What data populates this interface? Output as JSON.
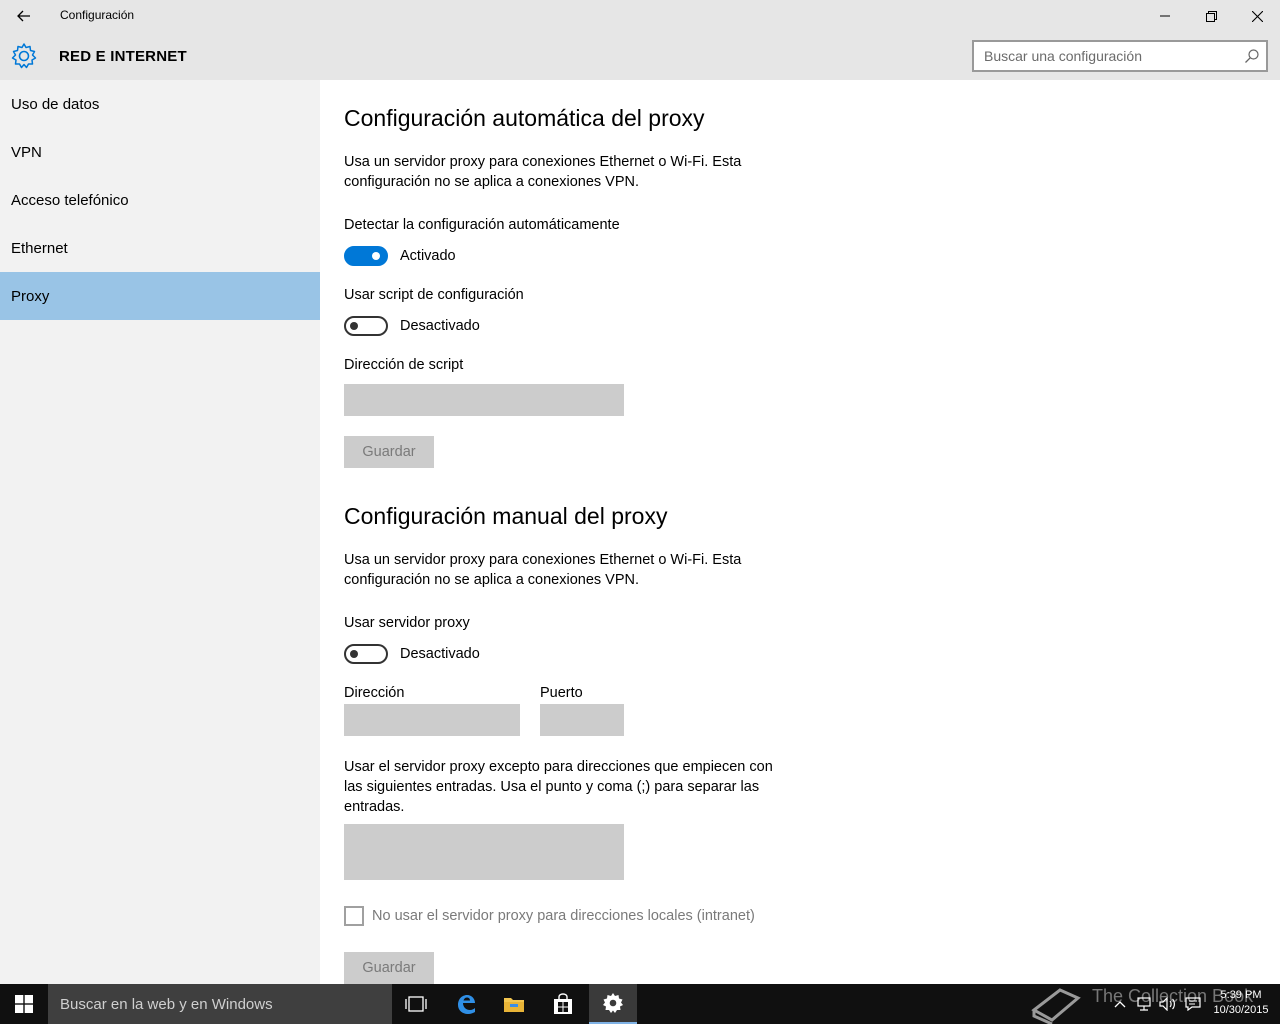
{
  "window": {
    "title": "Configuración"
  },
  "header": {
    "section_title": "RED E INTERNET",
    "search_placeholder": "Buscar una configuración"
  },
  "sidebar": {
    "items": [
      {
        "label": "Uso de datos",
        "selected": false
      },
      {
        "label": "VPN",
        "selected": false
      },
      {
        "label": "Acceso telefónico",
        "selected": false
      },
      {
        "label": "Ethernet",
        "selected": false
      },
      {
        "label": "Proxy",
        "selected": true
      }
    ]
  },
  "auto": {
    "heading": "Configuración automática del proxy",
    "description": "Usa un servidor proxy para conexiones Ethernet o Wi-Fi. Esta configuración no se aplica a conexiones VPN.",
    "detect_label": "Detectar la configuración automáticamente",
    "detect_state": "Activado",
    "script_label": "Usar script de configuración",
    "script_state": "Desactivado",
    "script_address_label": "Dirección de script",
    "script_address_value": "",
    "save_label": "Guardar"
  },
  "manual": {
    "heading": "Configuración manual del proxy",
    "description": "Usa un servidor proxy para conexiones Ethernet o Wi-Fi. Esta configuración no se aplica a conexiones VPN.",
    "use_proxy_label": "Usar servidor proxy",
    "use_proxy_state": "Desactivado",
    "address_label": "Dirección",
    "address_value": "",
    "port_label": "Puerto",
    "port_value": "",
    "exceptions_label": "Usar el servidor proxy excepto para direcciones que empiecen con las siguientes entradas. Usa el punto y coma (;) para separar las entradas.",
    "exceptions_value": "",
    "local_checkbox_label": "No usar el servidor proxy para direcciones locales (intranet)",
    "local_checked": false,
    "save_label": "Guardar"
  },
  "taskbar": {
    "search_placeholder": "Buscar en la web y en Windows",
    "time": "5:39 PM",
    "date": "10/30/2015",
    "watermark": "The Collection Book"
  },
  "colors": {
    "accent": "#0078d7",
    "selected_nav": "#99c4e6",
    "taskbar": "#101010"
  }
}
